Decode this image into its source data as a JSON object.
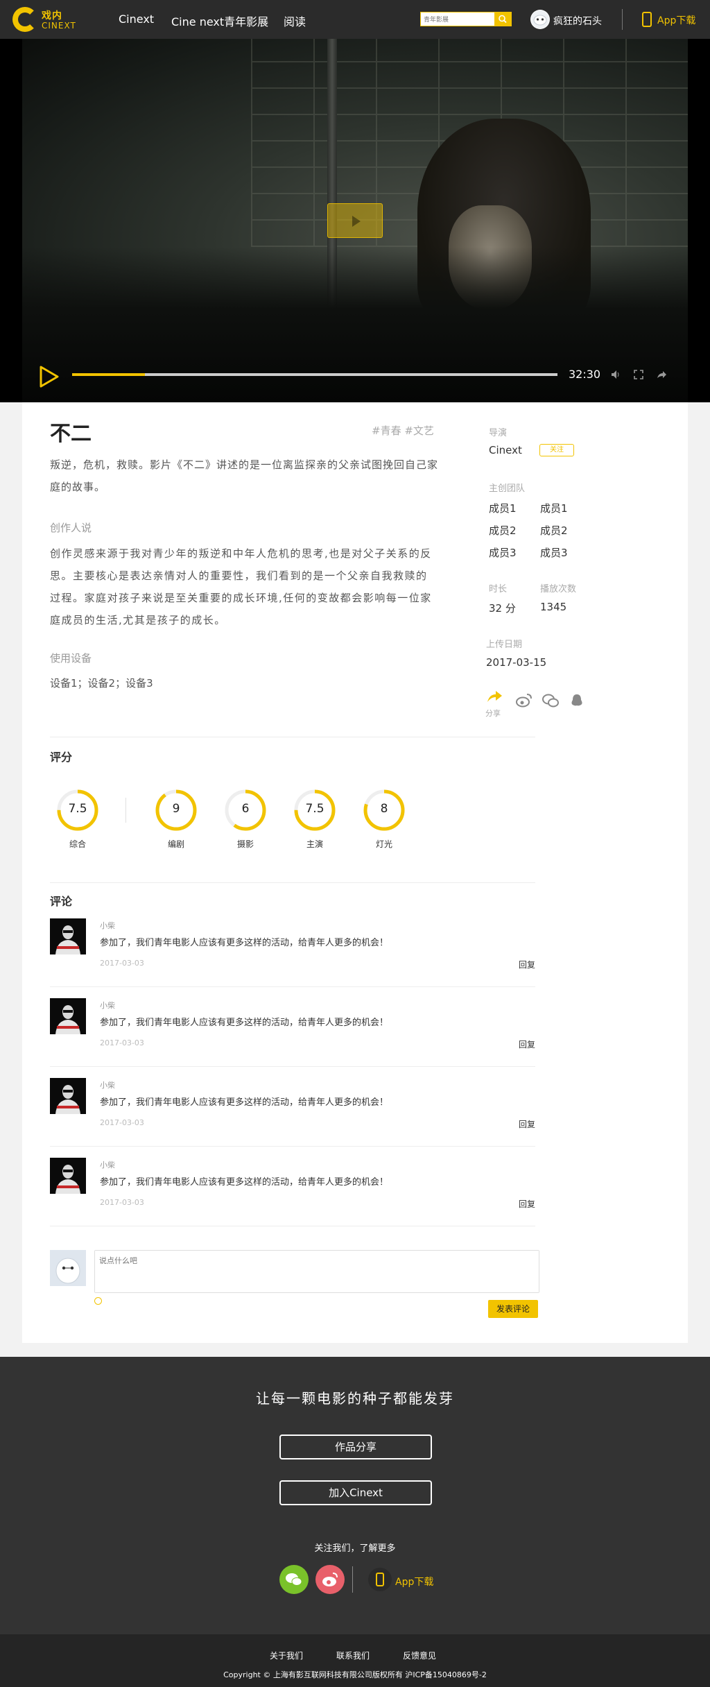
{
  "header": {
    "logo_cn": "戏内",
    "logo_en": "CINEXT",
    "nav": [
      "Cinext",
      "Cine next青年影展",
      "阅读"
    ],
    "search_placeholder": "青年影展",
    "username": "疯狂的石头",
    "app_download": "App下载"
  },
  "player": {
    "duration": "32:30",
    "progress_fraction": 0.15
  },
  "film": {
    "title": "不二",
    "tags": "#青春 #文艺",
    "description": "叛逆，危机，救赎。影片《不二》讲述的是一位离监探亲的父亲试图挽回自己家庭的故事。",
    "creator_heading": "创作人说",
    "creator_text": "创作灵感来源于我对青少年的叛逆和中年人危机的思考,也是对父子关系的反思。主要核心是表达亲情对人的重要性，我们看到的是一个父亲自我救赎的过程。家庭对孩子来说是至关重要的成长环境,任何的变故都会影响每一位家庭成员的生活,尤其是孩子的成长。",
    "equipment_heading": "使用设备",
    "equipment": "设备1；设备2；设备3"
  },
  "sidebar": {
    "director_label": "导演",
    "director": "Cinext",
    "follow": "关注",
    "team_label": "主创团队",
    "members": [
      "成员1",
      "成员1",
      "成员2",
      "成员2",
      "成员3",
      "成员3"
    ],
    "duration_label": "时长",
    "duration": "32 分",
    "plays_label": "播放次数",
    "plays": "1345",
    "upload_label": "上传日期",
    "upload_date": "2017-03-15",
    "share_label": "分享"
  },
  "ratings": {
    "heading": "评分",
    "items": [
      {
        "label": "综合",
        "value": "7.5",
        "score": 7.5
      },
      {
        "label": "编剧",
        "value": "9",
        "score": 9
      },
      {
        "label": "摄影",
        "value": "6",
        "score": 6
      },
      {
        "label": "主演",
        "value": "7.5",
        "score": 7.5
      },
      {
        "label": "灯光",
        "value": "8",
        "score": 8
      }
    ]
  },
  "comments": {
    "heading": "评论",
    "items": [
      {
        "name": "小柴",
        "text": "参加了，我们青年电影人应该有更多这样的活动，给青年人更多的机会！",
        "date": "2017-03-03",
        "reply": "回复"
      },
      {
        "name": "小柴",
        "text": "参加了，我们青年电影人应该有更多这样的活动，给青年人更多的机会！",
        "date": "2017-03-03",
        "reply": "回复"
      },
      {
        "name": "小柴",
        "text": "参加了，我们青年电影人应该有更多这样的活动，给青年人更多的机会！",
        "date": "2017-03-03",
        "reply": "回复"
      },
      {
        "name": "小柴",
        "text": "参加了，我们青年电影人应该有更多这样的活动，给青年人更多的机会！",
        "date": "2017-03-03",
        "reply": "回复"
      }
    ],
    "input_placeholder": "说点什么吧",
    "submit": "发表评论"
  },
  "footer": {
    "slogan": "让每一颗电影的种子都能发芽",
    "btn_share": "作品分享",
    "btn_join": "加入Cinext",
    "follow_us": "关注我们，了解更多",
    "app_download": "App下载",
    "links": [
      "关于我们",
      "联系我们",
      "反馈意见"
    ],
    "copyright": "Copyright © 上海有影互联网科技有限公司版权所有 沪ICP备15040869号-2"
  },
  "colors": {
    "accent": "#f2c300",
    "header_bg": "#2b2b2b",
    "footer_bg": "#333333",
    "wechat": "#7ac22a",
    "weibo": "#e8606a"
  }
}
